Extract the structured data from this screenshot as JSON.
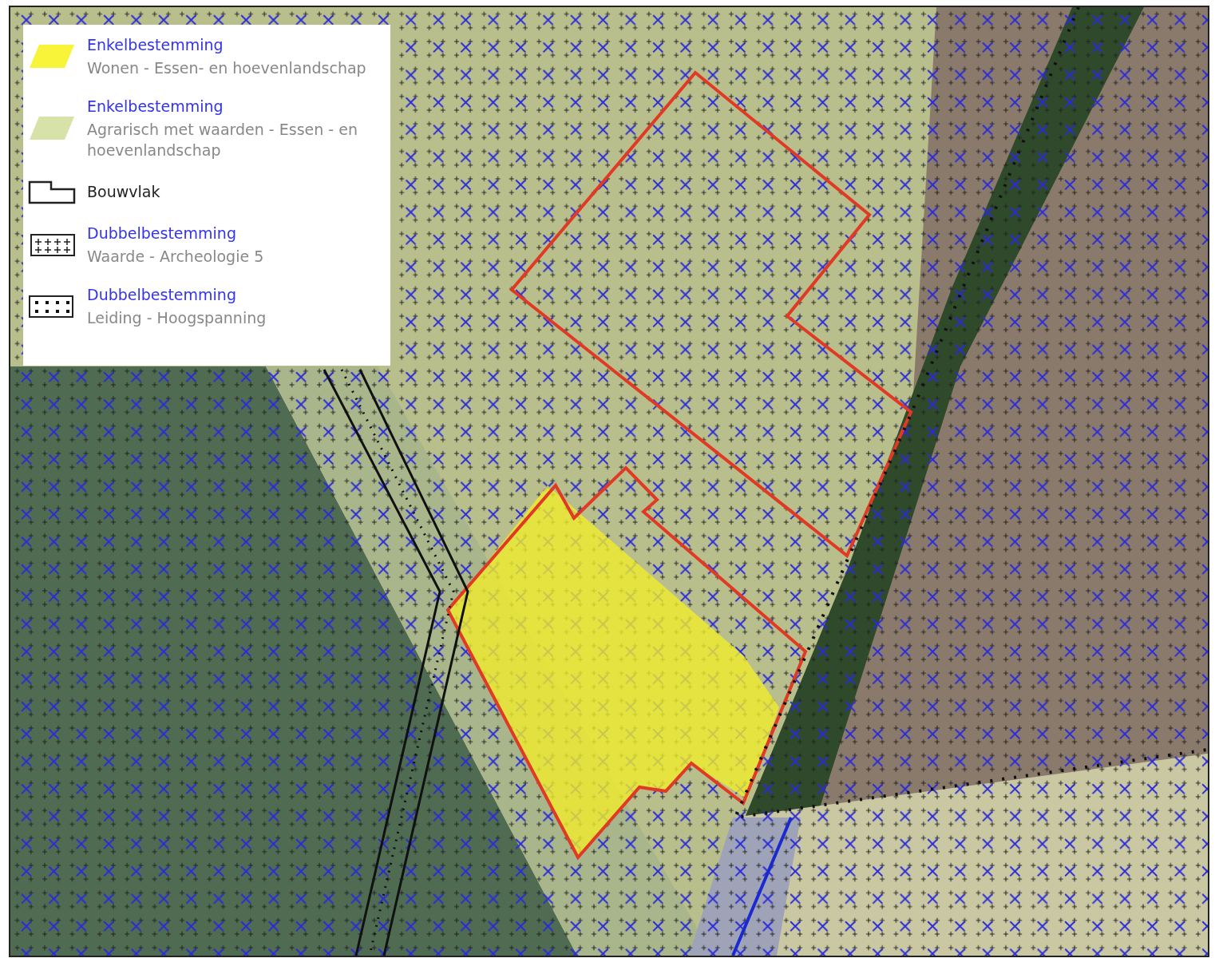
{
  "legend": {
    "items": [
      {
        "kind": "fill",
        "color": "#f7f43a",
        "title": "Enkelbestemming",
        "description": "Wonen - Essen- en hoevenlandschap"
      },
      {
        "kind": "fill",
        "color": "#d6e2a8",
        "title": "Enkelbestemming",
        "description": "Agrarisch met waarden - Essen - en hoevenlandschap"
      },
      {
        "kind": "outline",
        "label": "Bouwvlak"
      },
      {
        "kind": "crosses",
        "title": "Dubbelbestemming",
        "description": "Waarde - Archeologie 5"
      },
      {
        "kind": "dots",
        "title": "Dubbelbestemming",
        "description": "Leiding - Hoogspanning"
      }
    ]
  }
}
